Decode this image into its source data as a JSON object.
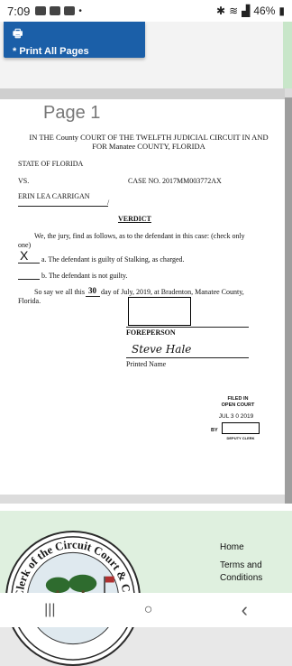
{
  "status_bar": {
    "time": "7:09",
    "battery": "46%"
  },
  "toolbar": {
    "print_label": "Print All Pages"
  },
  "document": {
    "page_label": "Page 1",
    "court_line1": "IN THE County COURT OF THE TWELFTH JUDICIAL CIRCUIT IN AND",
    "court_line2": "FOR Manatee COUNTY, FLORIDA",
    "plaintiff": "STATE OF FLORIDA",
    "vs": "VS.",
    "case_no": "CASE NO. 2017MM003772AX",
    "defendant": "ERIN LEA CARRIGAN",
    "title": "VERDICT",
    "intro_line1": "We, the jury, find as follows, as to the defendant in this case:  (check only",
    "intro_line2": "one)",
    "option_a": "a.  The defendant is guilty of Stalking, as charged.",
    "option_a_mark": "X",
    "option_b": "b.  The defendant is not guilty.",
    "closing_prefix": "So say we all this",
    "closing_day": "30",
    "closing_suffix": "day of July, 2019, at Bradenton, Manatee County,",
    "closing_line2": "Florida.",
    "foreperson_label": "FOREPERSON",
    "signature": "Steve Hale",
    "printed_name_label": "Printed Name",
    "stamp_line1": "FILED IN",
    "stamp_line2": "OPEN COURT",
    "stamp_date": "JUL 3 0 2019",
    "stamp_prefix": "BY",
    "stamp_clerk": "DEPUTY CLERK"
  },
  "footer": {
    "seal_text": "Clerk of the Circuit Court & Comptroller",
    "links": [
      "Home",
      "Terms and",
      "Conditions"
    ]
  },
  "nav": {
    "recent": "|||",
    "home": "○",
    "back": "‹"
  }
}
